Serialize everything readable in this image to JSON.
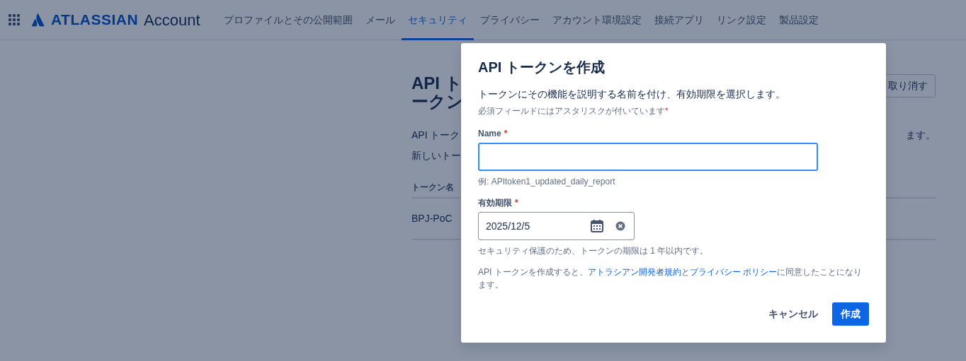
{
  "nav": {
    "logo_brand": "ATLASSIAN",
    "logo_product": "Account",
    "tabs": [
      {
        "label": "プロファイルとその公開範囲",
        "selected": false
      },
      {
        "label": "メール",
        "selected": false
      },
      {
        "label": "セキュリティ",
        "selected": true
      },
      {
        "label": "プライバシー",
        "selected": false
      },
      {
        "label": "アカウント環境設定",
        "selected": false
      },
      {
        "label": "接続アプリ",
        "selected": false
      },
      {
        "label": "リンク設定",
        "selected": false
      },
      {
        "label": "製品設定",
        "selected": false
      }
    ]
  },
  "page": {
    "heading_lines": [
      "API ト",
      "ークン"
    ],
    "revoke_button": "取り消す",
    "intro_start": "API トーク",
    "intro_end": "ます。",
    "new_token_start": "新しいトー",
    "table": {
      "columns": [
        "トークン名"
      ],
      "rows": [
        [
          "BPJ-PoC"
        ]
      ]
    }
  },
  "dialog": {
    "title": "API トークンを作成",
    "description": "トークンにその機能を説明する名前を付け、有効期限を選択します。",
    "required_note": "必須フィールドにはアスタリスクが付いています",
    "required_mark": "*",
    "fields": [
      {
        "kind": "text",
        "label": "Name",
        "required": true,
        "focused": true,
        "helper": "例: APItoken1_updated_daily_report"
      },
      {
        "kind": "date",
        "label": "有効期限",
        "required": true,
        "focused": false,
        "value": "2025/12/5",
        "helper": "セキュリティ保護のため、トークンの期限は 1 年以内です。"
      }
    ],
    "terms": [
      {
        "text": "API トークンを作成すると、",
        "link": false
      },
      {
        "text": "アトラシアン開発者規約",
        "link": true
      },
      {
        "text": "と",
        "link": false
      },
      {
        "text": "プライバシー ポリシー",
        "link": true
      },
      {
        "text": "に同意したことになります。",
        "link": false
      }
    ],
    "buttons": [
      {
        "label": "キャンセル",
        "kind": "subtle"
      },
      {
        "label": "作成",
        "kind": "primary"
      }
    ]
  }
}
